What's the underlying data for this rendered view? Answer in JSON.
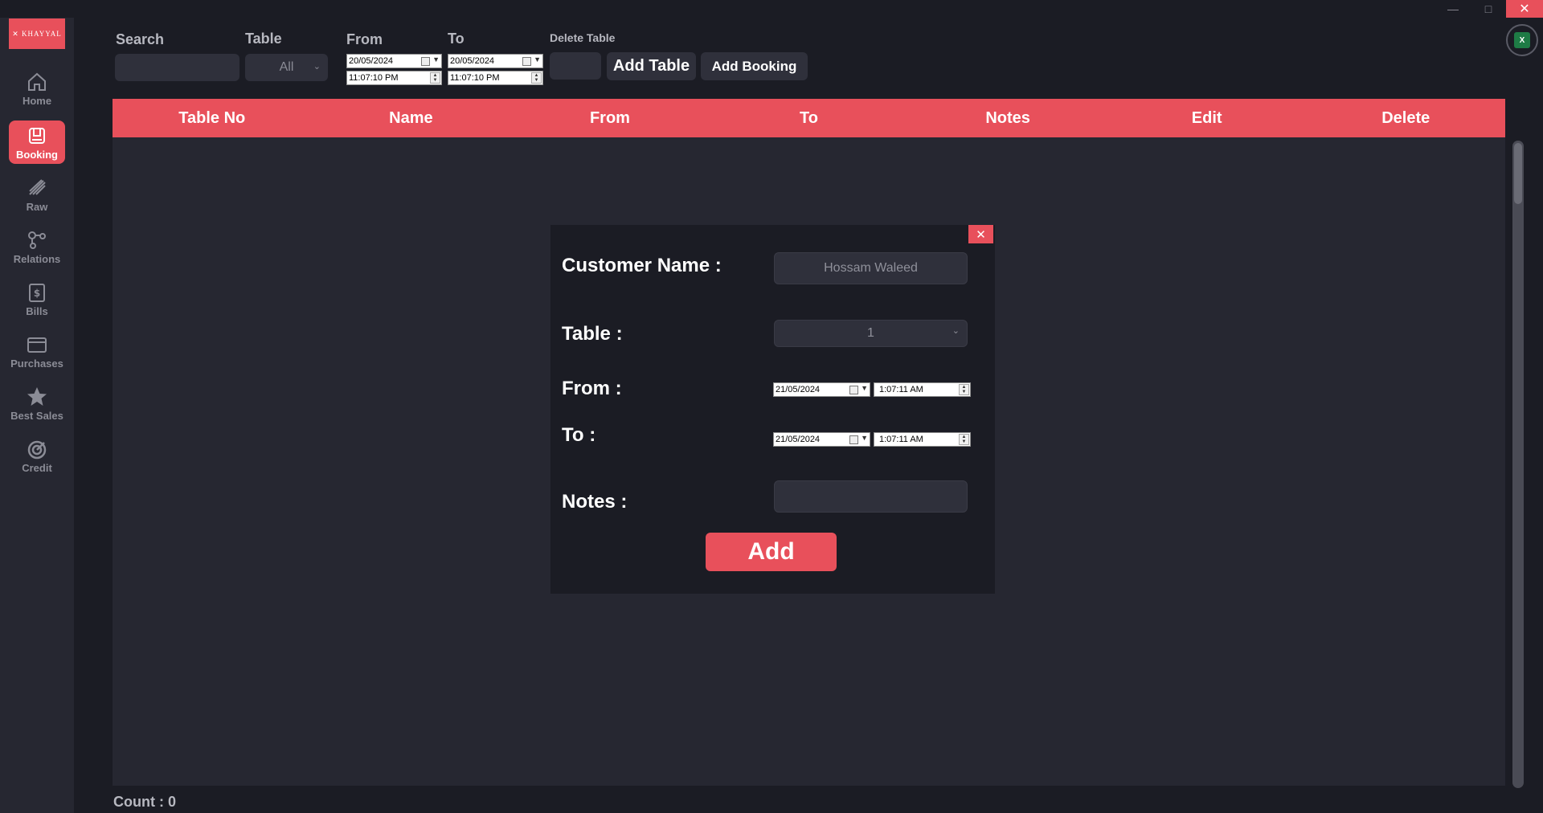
{
  "window": {
    "minimize": "—",
    "maximize": "□",
    "close": "✕"
  },
  "sidebar": {
    "logo": "✕ KHAYYAL",
    "items": [
      {
        "label": "Home",
        "icon": "home-icon"
      },
      {
        "label": "Booking",
        "icon": "booking-icon"
      },
      {
        "label": "Raw",
        "icon": "raw-icon"
      },
      {
        "label": "Relations",
        "icon": "relations-icon"
      },
      {
        "label": "Bills",
        "icon": "bills-icon"
      },
      {
        "label": "Purchases",
        "icon": "purchases-icon"
      },
      {
        "label": "Best Sales",
        "icon": "star-icon"
      },
      {
        "label": "Credit",
        "icon": "credit-icon"
      }
    ],
    "active": "Booking"
  },
  "toolbar": {
    "search_label": "Search",
    "search_value": "",
    "table_label": "Table",
    "table_value": "All",
    "from_label": "From",
    "from_date": "20/05/2024",
    "from_time": "11:07:10 PM",
    "to_label": "To",
    "to_date": "20/05/2024",
    "to_time": "11:07:10 PM",
    "delete_table_label": "Delete Table",
    "delete_table_value": "",
    "add_table": "Add Table",
    "add_booking": "Add Booking",
    "excel_icon": "excel-icon",
    "excel_text": "X"
  },
  "table": {
    "columns": [
      "Table No",
      "Name",
      "From",
      "To",
      "Notes",
      "Edit",
      "Delete"
    ],
    "rows": []
  },
  "count": {
    "label": "Count :",
    "value": "0"
  },
  "dialog": {
    "close": "✕",
    "customer_label": "Customer Name :",
    "customer_value": "Hossam Waleed",
    "table_label": "Table :",
    "table_value": "1",
    "from_label": "From :",
    "from_date": "21/05/2024",
    "from_time": "1:07:11 AM",
    "to_label": "To :",
    "to_date": "21/05/2024",
    "to_time": "1:07:11 AM",
    "notes_label": "Notes :",
    "notes_value": "",
    "add": "Add"
  },
  "colors": {
    "accent": "#e8505b",
    "background": "#1b1c24",
    "panel": "#262731",
    "input": "#2f303b"
  }
}
